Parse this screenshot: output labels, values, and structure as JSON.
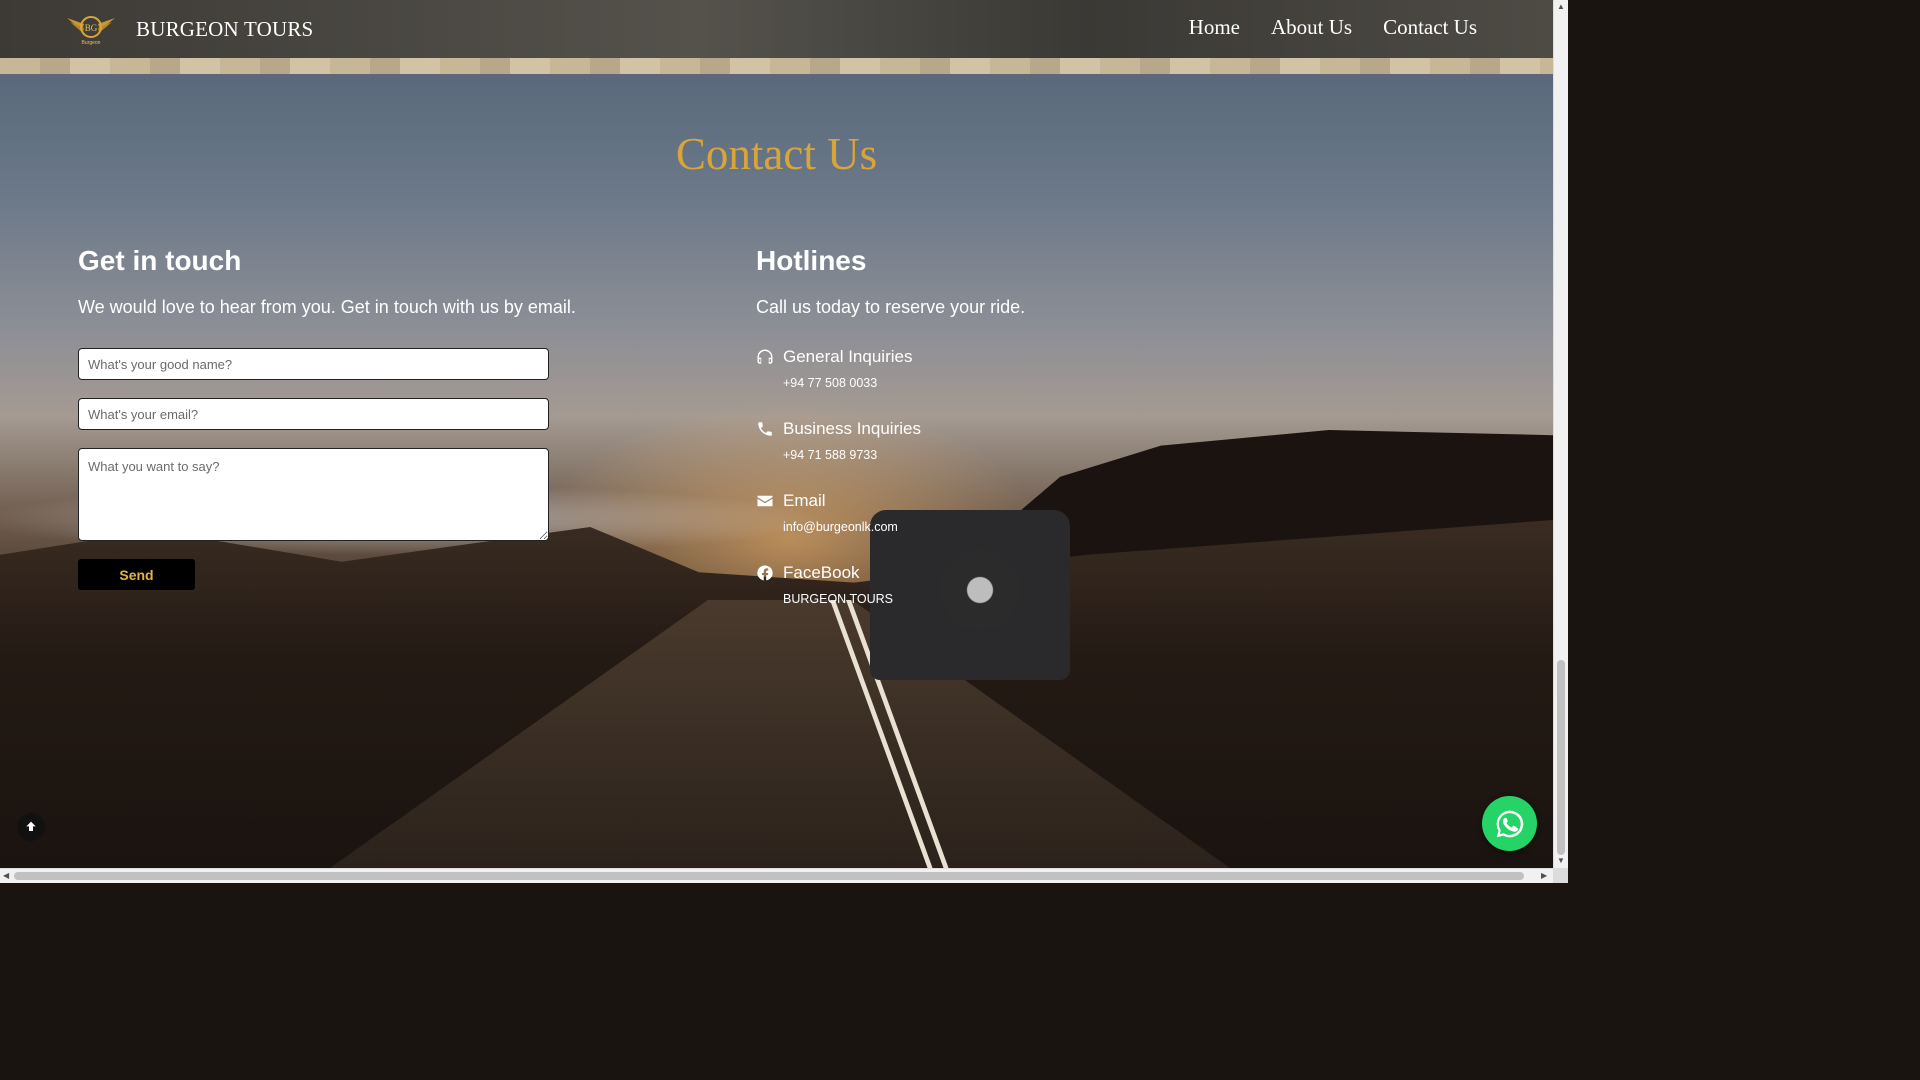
{
  "brand": {
    "name": "BURGEON TOURS",
    "logo_text": "BG",
    "logo_subtext": "Burgeon"
  },
  "nav": {
    "items": [
      "Home",
      "About Us",
      "Contact Us"
    ]
  },
  "page": {
    "heading": "Contact Us"
  },
  "get_in_touch": {
    "title": "Get in touch",
    "subtitle": "We would love to hear from you. Get in touch with us by email.",
    "name_placeholder": "What's your good name?",
    "email_placeholder": "What's your email?",
    "message_placeholder": "What you want to say?",
    "send_label": "Send"
  },
  "hotlines": {
    "title": "Hotlines",
    "subtitle": "Call us today to reserve your ride.",
    "items": [
      {
        "icon": "headset-icon",
        "label": "General Inquiries",
        "value": "+94 77 508 0033"
      },
      {
        "icon": "phone-icon",
        "label": "Business Inquiries",
        "value": "+94 71 588 9733"
      },
      {
        "icon": "envelope-icon",
        "label": "Email",
        "value": "info@burgeonlk.com"
      },
      {
        "icon": "facebook-icon",
        "label": "FaceBook",
        "value": "BURGEON TOURS"
      }
    ]
  },
  "colors": {
    "accent_gold": "#d8a53a",
    "button_text": "#e3b43b",
    "whatsapp_green": "#25d366"
  }
}
